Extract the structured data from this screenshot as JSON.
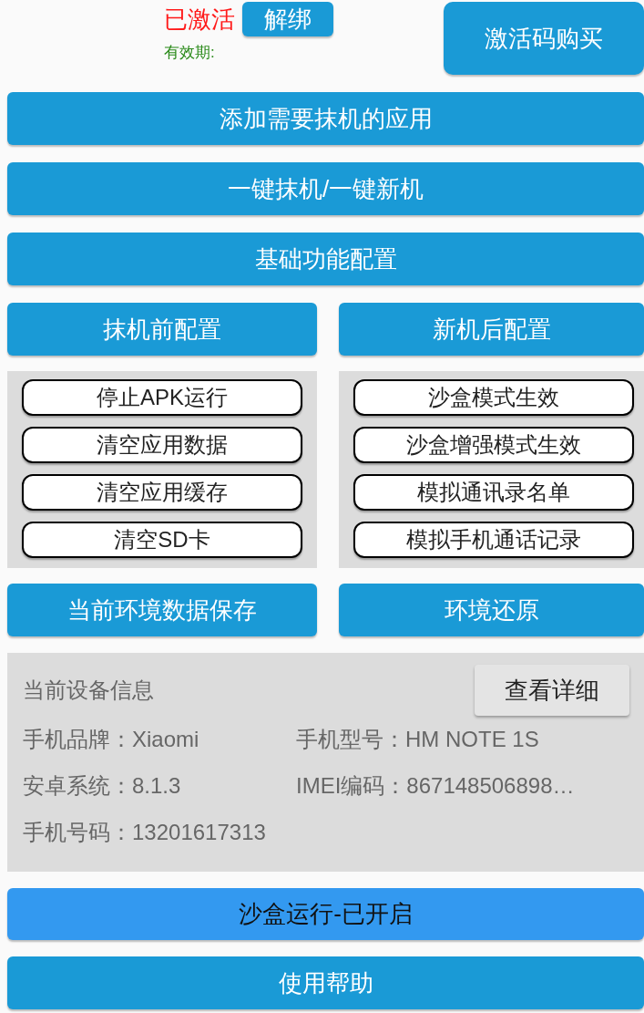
{
  "activation": {
    "status": "已激活",
    "unbind_button": "解绑",
    "validity_label": "有效期:",
    "buy_button": "激活码购买"
  },
  "main_buttons": [
    "添加需要抹机的应用",
    "一键抹机/一键新机",
    "基础功能配置"
  ],
  "config_tabs": [
    "抹机前配置",
    "新机后配置"
  ],
  "option_panels": [
    {
      "options": [
        "停止APK运行",
        "清空应用数据",
        "清空应用缓存",
        "清空SD卡"
      ]
    },
    {
      "options": [
        "沙盒模式生效",
        "沙盒增强模式生效",
        "模拟通讯录名单",
        "模拟手机通话记录"
      ]
    }
  ],
  "env_buttons": [
    "当前环境数据保存",
    "环境还原"
  ],
  "device_info": {
    "title": "当前设备信息",
    "detail_button": "查看详细",
    "fields": [
      {
        "label": "手机品牌：",
        "value": "Xiaomi"
      },
      {
        "label": "手机型号：",
        "value": "HM NOTE 1S"
      },
      {
        "label": "安卓系统：",
        "value": "8.1.3"
      },
      {
        "label": "IMEI编码：",
        "value": "867148506898…"
      },
      {
        "label": "手机号码：",
        "value": "13201617313"
      }
    ]
  },
  "sandbox_button": {
    "label": "沙盒运行-已开启",
    "on": true
  },
  "help_button": "使用帮助"
}
